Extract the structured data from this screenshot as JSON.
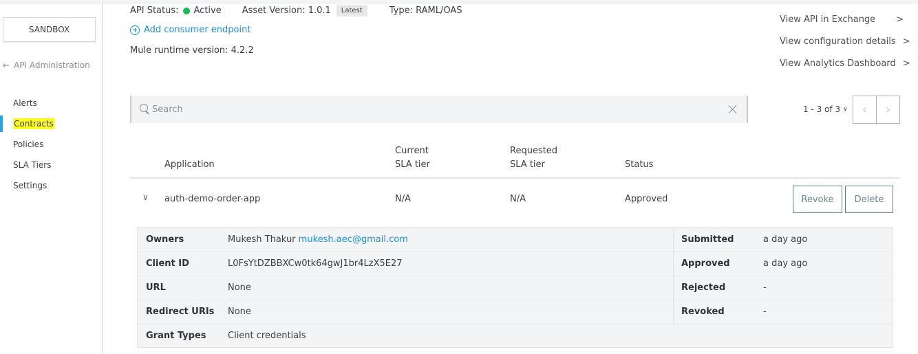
{
  "sidebar": {
    "environment_button": "SANDBOX",
    "back_link": "API Administration",
    "back_icon": "arrow-left-icon",
    "items": [
      {
        "label": "Alerts",
        "active": false
      },
      {
        "label": "Contracts",
        "active": true
      },
      {
        "label": "Policies",
        "active": false
      },
      {
        "label": "SLA Tiers",
        "active": false
      },
      {
        "label": "Settings",
        "active": false
      }
    ]
  },
  "header": {
    "api_status_label": "API Status:",
    "api_status_value": "Active",
    "api_status_color": "#1eb85b",
    "asset_version": "Asset Version: 1.0.1",
    "latest_badge": "Latest",
    "type": "Type: RAML/OAS",
    "add_endpoint_label": "Add consumer endpoint",
    "runtime_version": "Mule runtime version: 4.2.2"
  },
  "side_links": [
    {
      "label": "View API in Exchange",
      "icon": "chevron-right-icon"
    },
    {
      "label": "View configuration details",
      "icon": "chevron-right-icon"
    },
    {
      "label": "View Analytics Dashboard",
      "icon": "chevron-right-icon"
    }
  ],
  "search": {
    "placeholder": "Search",
    "value": ""
  },
  "pagination": {
    "label": "1 - 3 of 3",
    "prev": "‹",
    "next": "›"
  },
  "table": {
    "columns": {
      "application": "Application",
      "current_sla_line1": "Current",
      "current_sla_line2": "SLA tier",
      "requested_sla_line1": "Requested",
      "requested_sla_line2": "SLA tier",
      "status": "Status"
    },
    "rows": [
      {
        "application": "auth-demo-order-app",
        "current_sla": "N/A",
        "requested_sla": "N/A",
        "status": "Approved",
        "revoke_label": "Revoke",
        "delete_label": "Delete",
        "details": {
          "owners_label": "Owners",
          "owners_name": "Mukesh Thakur",
          "owners_email": "mukesh.aec@gmail.com",
          "client_id_label": "Client ID",
          "client_id": "L0FsYtDZBBXCw0tk64gwJ1br4LzX5E27",
          "url_label": "URL",
          "url": "None",
          "redirect_label": "Redirect URIs",
          "redirect": "None",
          "grant_label": "Grant Types",
          "grant": "Client credentials",
          "submitted_label": "Submitted",
          "submitted": "a day ago",
          "approved_label": "Approved",
          "approved": "a day ago",
          "rejected_label": "Rejected",
          "rejected": "-",
          "revoked_label": "Revoked",
          "revoked": "-"
        }
      }
    ]
  }
}
